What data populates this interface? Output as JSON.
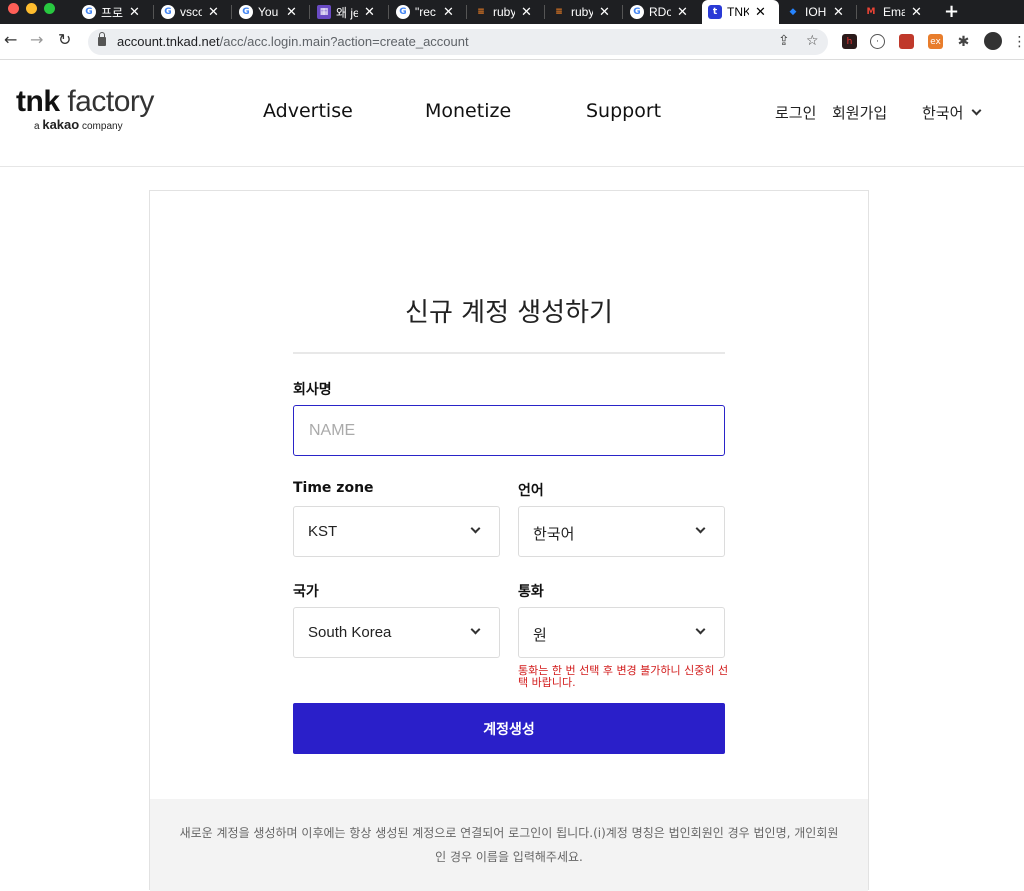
{
  "browser": {
    "tabs": [
      {
        "label": "프로",
        "favicon": "google-icon",
        "glyph": "G"
      },
      {
        "label": "vsco",
        "favicon": "google-icon",
        "glyph": "G"
      },
      {
        "label": "You",
        "favicon": "google-icon",
        "glyph": "G"
      },
      {
        "label": "왜 je",
        "favicon": "image-icon",
        "glyph": "▦"
      },
      {
        "label": "\"rec",
        "favicon": "google-icon",
        "glyph": "G"
      },
      {
        "label": "ruby",
        "favicon": "stackoverflow-icon",
        "glyph": "≡"
      },
      {
        "label": "ruby",
        "favicon": "stackoverflow-icon",
        "glyph": "≡"
      },
      {
        "label": "RDo",
        "favicon": "google-icon",
        "glyph": "G"
      },
      {
        "label": "TNK",
        "favicon": "tnk-icon",
        "glyph": "t",
        "active": true
      },
      {
        "label": "IOH",
        "favicon": "jira-icon",
        "glyph": "◆"
      },
      {
        "label": "Ema",
        "favicon": "gmail-icon",
        "glyph": "M"
      }
    ],
    "close_glyph": "✕",
    "new_tab_glyph": "+",
    "url_host": "account.tnkad.net",
    "url_path": "/acc/acc.login.main?action=create_account"
  },
  "header": {
    "logo_bold": "tnk",
    "logo_light": "factory",
    "logo_sub_prefix": "a ",
    "logo_sub_brand": "kakao",
    "logo_sub_suffix": " company",
    "nav": [
      "Advertise",
      "Monetize",
      "Support"
    ],
    "login": "로그인",
    "signup": "회원가입",
    "language": "한국어"
  },
  "form": {
    "title": "신규 계정 생성하기",
    "company_label": "회사명",
    "company_placeholder": "NAME",
    "timezone_label": "Time zone",
    "timezone_value": "KST",
    "language_label": "언어",
    "language_value": "한국어",
    "country_label": "국가",
    "country_value": "South Korea",
    "currency_label": "통화",
    "currency_value": "원",
    "currency_notice": "통화는 한 번 선택 후 변경 불가하니 신중히 선택 바랍니다.",
    "submit_label": "계정생성",
    "footer_note_line1": "새로운 계정을 생성하며 이후에는 항상 생성된 계정으로 연결되어 로그인이 됩니다.(i)계정 명칭은 법인회원인 경우 법인명, 개인회원",
    "footer_note_line2": "인 경우 이름을 입력해주세요."
  },
  "colors": {
    "primary": "#2a1fc9",
    "notice_red": "#d21b1b",
    "footer_bg": "#f3f3f3"
  }
}
